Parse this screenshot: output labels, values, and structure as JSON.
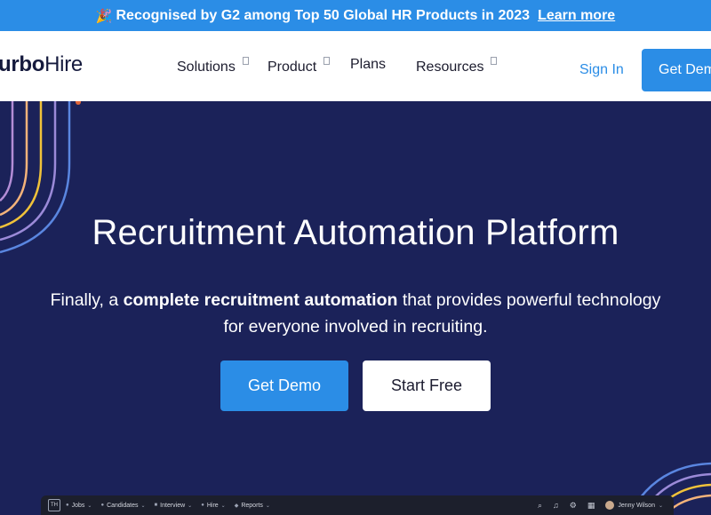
{
  "announcement": {
    "icon": "party-popper-icon",
    "emoji": "🎉",
    "text": "Recognised by G2 among Top 50 Global HR Products in 2023",
    "link": "Learn more"
  },
  "nav": {
    "logo_prefix": "urbo",
    "logo_suffix": "Hire",
    "items": [
      {
        "label": "Solutions",
        "has_dropdown": true
      },
      {
        "label": "Product",
        "has_dropdown": true
      },
      {
        "label": "Plans",
        "has_dropdown": false
      },
      {
        "label": "Resources",
        "has_dropdown": true
      }
    ],
    "sign_in": "Sign In",
    "get_demo": "Get Demo"
  },
  "hero": {
    "title": "Recruitment Automation Platform",
    "subtitle_prefix": "Finally, a ",
    "subtitle_bold": "complete recruitment automation",
    "subtitle_suffix": " that provides powerful technology for everyone involved in recruiting.",
    "primary_button": "Get Demo",
    "secondary_button": "Start Free"
  },
  "colors": {
    "accent": "#2b8de6",
    "hero_bg": "#1b2259",
    "nav_bg": "#ffffff"
  },
  "app_preview": {
    "logo": "TH",
    "tabs": [
      {
        "label": "Jobs",
        "icon": "briefcase-icon"
      },
      {
        "label": "Candidates",
        "icon": "people-icon"
      },
      {
        "label": "Interview",
        "icon": "calendar-icon"
      },
      {
        "label": "Hire",
        "icon": "hire-icon"
      },
      {
        "label": "Reports",
        "icon": "chart-icon"
      }
    ],
    "user": "Jenny Wilson"
  }
}
